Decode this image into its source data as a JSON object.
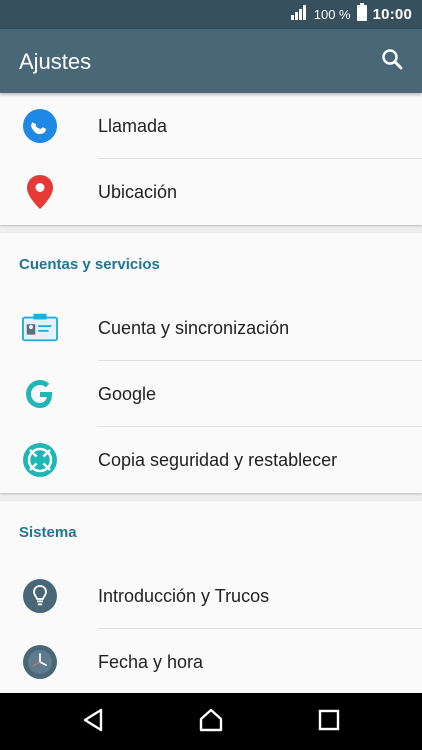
{
  "status_bar": {
    "battery_percent": "100 %",
    "time": "10:00",
    "icons": [
      "signal-icon",
      "battery-icon"
    ]
  },
  "app_bar": {
    "title": "Ajustes",
    "search_icon": "search-icon"
  },
  "sections": {
    "top": {
      "items": [
        {
          "label": "Llamada",
          "icon": "phone-icon",
          "color": "#1e88e5"
        },
        {
          "label": "Ubicación",
          "icon": "location-pin-icon",
          "color": "#e53935"
        }
      ]
    },
    "accounts": {
      "header": "Cuentas y servicios",
      "items": [
        {
          "label": "Cuenta y sincronización",
          "icon": "account-card-icon",
          "color": "#29a9e0"
        },
        {
          "label": "Google",
          "icon": "google-icon",
          "color": "#20b6b6"
        },
        {
          "label": "Copia seguridad y restablecer",
          "icon": "backup-restore-icon",
          "color": "#20b6b6"
        }
      ]
    },
    "system": {
      "header": "Sistema",
      "items": [
        {
          "label": "Introducción y Trucos",
          "icon": "lightbulb-icon",
          "color": "#4a6778"
        },
        {
          "label": "Fecha y hora",
          "icon": "clock-icon",
          "color": "#4a6778"
        }
      ]
    }
  },
  "nav_bar": {
    "buttons": [
      "back-icon",
      "home-icon",
      "recents-icon"
    ]
  },
  "colors": {
    "status_bar": "#37505e",
    "app_bar": "#4a6778",
    "section_header": "#1f7694",
    "background": "#eeeeee",
    "card": "#fafafa"
  }
}
